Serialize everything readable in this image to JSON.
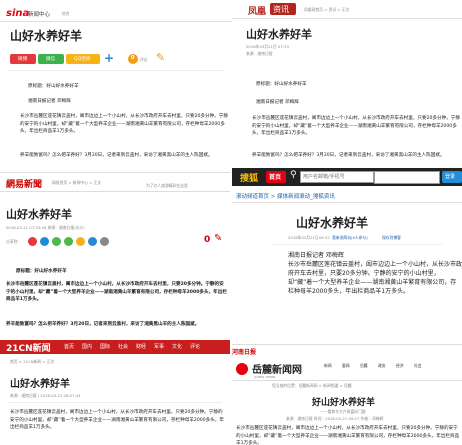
{
  "title": "山好水养好羊",
  "pre_text": "原标题：好山好水养好羊",
  "source_line": "湘南日报记者 邓梅辉",
  "para1": "长沙市岳麓区莲花镇云盖村，阖市边边上一个小山村，从长沙市政府开车去村里，只要20多分钟。宁静的安宁的小山村里，却“藏”着一个大型养羊企业——湖南湘黄山羊繁育有限公司，存栏种母羊2000多头，年出栏商品羊1万多头。",
  "para2": "养羊能致富吗？怎么把羊养好？3月20日，记者来到云盖村，采访了湘黄黑山羊的主人陈国斌。",
  "panel1": {
    "logo": "sina",
    "logo2": "新闻中心",
    "nav": "综合",
    "title": "山好水养好羊",
    "share": [
      "微博",
      "微信",
      "QQ空间"
    ],
    "comment_count": "0",
    "comment_label": "评论"
  },
  "panel2": {
    "logo": "凤凰",
    "logo2": "资讯",
    "nav": "凤凰网首页 > 资讯 > 正文",
    "title": "山好水养好羊",
    "meta": "2016年03月21日 07:33",
    "source": "来源：湘南日报"
  },
  "panel3": {
    "logo": "網易新聞",
    "nav": "网易首页 > 新闻中心 > 正文",
    "ad": "为了亿人旅游精彩在这里",
    "title": "山好水养好羊",
    "meta": "2016-03-21 07:33:49 来源：湘南日报(长沙)",
    "share_label": "分享到："
  },
  "panel4": {
    "logo": "搜狐",
    "home": "首页",
    "search_placeholder": "用户名邮箱/手机号",
    "search_btn": "登录",
    "nav": "滚动频道首页 > 媒体新闻滚动_搜狐资讯",
    "title": "山好水养好羊",
    "meta": "2016年03月21日09:52",
    "meta2": "我来说两句(0人参与)",
    "meta3": "保存到博客",
    "pre": "湘南日报记者 邓梅辉"
  },
  "panel5": {
    "logo": "21CN新闻",
    "nav_items": [
      "首页",
      "国内",
      "国际",
      "社会",
      "财经",
      "军事",
      "文化",
      "评论"
    ],
    "nav": "首页 > 21CN新闻 > 正文",
    "title": "山好水养好羊",
    "meta": "来源：湘南日报 | 2016-03-21 06:27:44"
  },
  "panel6": {
    "logo_small": "河南日报",
    "logo": "岳麓新闻网",
    "logo_en": "yuelu news",
    "nav_items": [
      "新闻",
      "要闻",
      "岳麓",
      "政务",
      "经济",
      "社会"
    ],
    "nav": "您当前的位置：岳麓新闻网 > 新闻频道 > 岳麓",
    "title": "好山好水养好羊",
    "subtitle": "一一看养羊大户致富好门路",
    "meta": "来源：湘南日报  时间：2016-03-21 09:27  作者：邓梅辉"
  }
}
